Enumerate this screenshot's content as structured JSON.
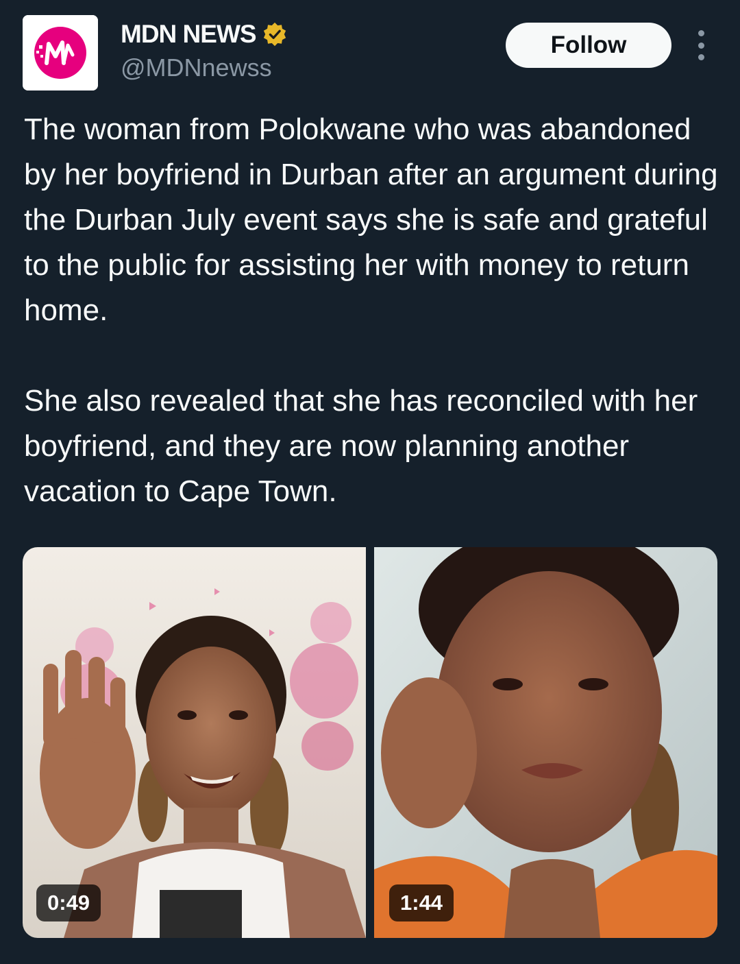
{
  "header": {
    "display_name": "MDN NEWS",
    "handle": "@MDNnewss",
    "follow_label": "Follow",
    "avatar_icon": "mdn-logo-icon",
    "verified_icon": "verified-badge-icon",
    "more_icon": "more-options-icon"
  },
  "tweet": {
    "paragraphs": [
      "The woman from Polokwane who was abandoned by her boyfriend in Durban after an argument during the Durban July event says she is safe and grateful to the public for assisting her with money to return home.",
      "She also revealed that she has reconciled with her boyfriend, and they are now planning another vacation to Cape Town."
    ]
  },
  "media": [
    {
      "duration": "0:49"
    },
    {
      "duration": "1:44"
    }
  ],
  "colors": {
    "background": "#15202b",
    "text": "#f7f9f9",
    "secondary_text": "#8b98a5",
    "brand_pink": "#e6007e",
    "verified_gold": "#e8b829"
  }
}
